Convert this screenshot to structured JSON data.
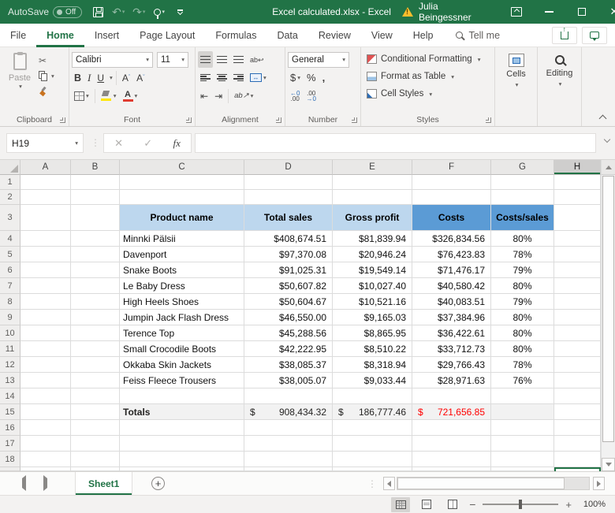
{
  "colors": {
    "excel_green": "#217346",
    "header_fill_light": "#BDD7EE",
    "header_fill_dark": "#5B9BD5",
    "totals_fill": "#F2F2F2",
    "costs_total_red": "#FF0000"
  },
  "titlebar": {
    "autosave_label": "AutoSave",
    "autosave_state": "Off",
    "title": "Excel calculated.xlsx - Excel",
    "user": "Julia Beingessner"
  },
  "tabs": [
    "File",
    "Home",
    "Insert",
    "Page Layout",
    "Formulas",
    "Data",
    "Review",
    "View",
    "Help"
  ],
  "search": {
    "label": "Tell me"
  },
  "ribbon": {
    "clipboard": {
      "label": "Clipboard",
      "paste_label": "Paste"
    },
    "font": {
      "label": "Font",
      "family": "Calibri",
      "size": "11",
      "bold": "B",
      "italic": "I",
      "underline": "U",
      "letter": "A"
    },
    "alignment": {
      "label": "Alignment",
      "wrap_top": "ab",
      "orientation": "ab"
    },
    "number": {
      "label": "Number",
      "format": "General",
      "currency": "$",
      "percent": "%",
      "comma": ",",
      "inc_top": "←0",
      "inc_bottom": ".00",
      "dec_top": ".00",
      "dec_bottom": "→0"
    },
    "styles": {
      "label": "Styles",
      "conditional_formatting": "Conditional Formatting",
      "format_as_table": "Format as Table",
      "cell_styles": "Cell Styles"
    },
    "cells": {
      "label": "Cells"
    },
    "editing": {
      "label": "Editing"
    }
  },
  "formula_bar": {
    "cell_reference": "H19",
    "formula": "",
    "fx_label": "fx"
  },
  "sheet": {
    "columns": [
      "A",
      "B",
      "C",
      "D",
      "E",
      "F",
      "G",
      "H"
    ],
    "selected_column": "H",
    "selected_cell": "H19",
    "visible_rows": 18,
    "table": {
      "header_row": 3,
      "first_data_row": 4,
      "totals_row": 15,
      "headers": [
        "Product name",
        "Total sales",
        "Gross profit",
        "Costs",
        "Costs/sales"
      ],
      "rows": [
        {
          "name": "Minnki Pälsii",
          "total_sales": "$408,674.51",
          "gross_profit": "$81,839.94",
          "costs": "$326,834.56",
          "costs_sales": "80%"
        },
        {
          "name": "Davenport",
          "total_sales": "$97,370.08",
          "gross_profit": "$20,946.24",
          "costs": "$76,423.83",
          "costs_sales": "78%"
        },
        {
          "name": "Snake Boots",
          "total_sales": "$91,025.31",
          "gross_profit": "$19,549.14",
          "costs": "$71,476.17",
          "costs_sales": "79%"
        },
        {
          "name": "Le Baby Dress",
          "total_sales": "$50,607.82",
          "gross_profit": "$10,027.40",
          "costs": "$40,580.42",
          "costs_sales": "80%"
        },
        {
          "name": "High Heels Shoes",
          "total_sales": "$50,604.67",
          "gross_profit": "$10,521.16",
          "costs": "$40,083.51",
          "costs_sales": "79%"
        },
        {
          "name": "Jumpin Jack Flash Dress",
          "total_sales": "$46,550.00",
          "gross_profit": "$9,165.03",
          "costs": "$37,384.96",
          "costs_sales": "80%"
        },
        {
          "name": "Terence Top",
          "total_sales": "$45,288.56",
          "gross_profit": "$8,865.95",
          "costs": "$36,422.61",
          "costs_sales": "80%"
        },
        {
          "name": "Small Crocodile Boots",
          "total_sales": "$42,222.95",
          "gross_profit": "$8,510.22",
          "costs": "$33,712.73",
          "costs_sales": "80%"
        },
        {
          "name": "Okkaba Skin Jackets",
          "total_sales": "$38,085.37",
          "gross_profit": "$8,318.94",
          "costs": "$29,766.43",
          "costs_sales": "78%"
        },
        {
          "name": "Feiss Fleece Trousers",
          "total_sales": "$38,005.07",
          "gross_profit": "$9,033.44",
          "costs": "$28,971.63",
          "costs_sales": "76%"
        }
      ],
      "totals": {
        "label": "Totals",
        "total_sales_symbol": "$",
        "total_sales": "908,434.32",
        "gross_profit_symbol": "$",
        "gross_profit": "186,777.46",
        "costs_symbol": "$",
        "costs": "721,656.85"
      }
    }
  },
  "sheet_tabs": {
    "tabs": [
      "Sheet1"
    ],
    "active": "Sheet1"
  },
  "status_bar": {
    "zoom_level": "100%"
  }
}
